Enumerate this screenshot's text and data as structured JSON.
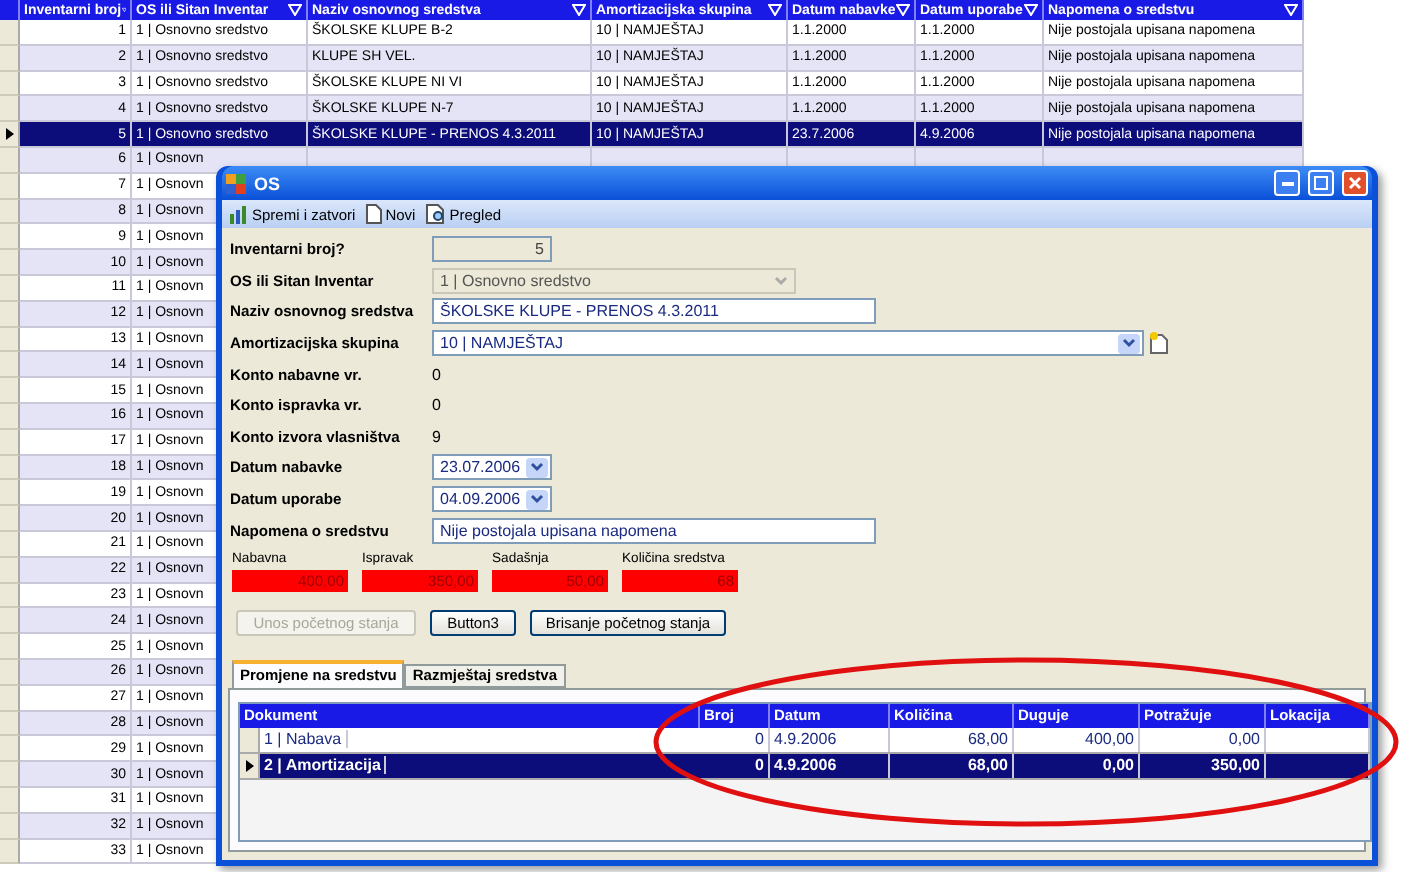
{
  "background_grid": {
    "columns": [
      "Inventarni broj",
      "OS ili Sitan Inventar",
      "Naziv osnovnog sredstva",
      "Amortizacijska skupina",
      "Datum nabavke",
      "Datum uporabe",
      "Napomena o sredstvu"
    ],
    "rows": [
      {
        "selected": false,
        "cells": [
          "1",
          "1 | Osnovno sredstvo",
          "ŠKOLSKE KLUPE B-2",
          "10 | NAMJEŠTAJ",
          "1.1.2000",
          "1.1.2000",
          "Nije postojala upisana napomena"
        ]
      },
      {
        "selected": false,
        "cells": [
          "2",
          "1 | Osnovno sredstvo",
          "KLUPE SH VEL.",
          "10 | NAMJEŠTAJ",
          "1.1.2000",
          "1.1.2000",
          "Nije postojala upisana napomena"
        ]
      },
      {
        "selected": false,
        "cells": [
          "3",
          "1 | Osnovno sredstvo",
          "ŠKOLSKE KLUPE NI VI",
          "10 | NAMJEŠTAJ",
          "1.1.2000",
          "1.1.2000",
          "Nije postojala upisana napomena"
        ]
      },
      {
        "selected": false,
        "cells": [
          "4",
          "1 | Osnovno sredstvo",
          "ŠKOLSKE KLUPE N-7",
          "10 | NAMJEŠTAJ",
          "1.1.2000",
          "1.1.2000",
          "Nije postojala upisana napomena"
        ]
      },
      {
        "selected": true,
        "cells": [
          "5",
          "1 | Osnovno sredstvo",
          "ŠKOLSKE KLUPE - PRENOS 4.3.2011",
          "10 | NAMJEŠTAJ",
          "23.7.2006",
          "4.9.2006",
          "Nije postojala upisana napomena"
        ]
      },
      {
        "selected": false,
        "cells": [
          "6",
          "1 | Osnovn"
        ]
      },
      {
        "selected": false,
        "cells": [
          "7",
          "1 | Osnovn"
        ]
      },
      {
        "selected": false,
        "cells": [
          "8",
          "1 | Osnovn"
        ]
      },
      {
        "selected": false,
        "cells": [
          "9",
          "1 | Osnovn"
        ]
      },
      {
        "selected": false,
        "cells": [
          "10",
          "1 | Osnovn"
        ]
      },
      {
        "selected": false,
        "cells": [
          "11",
          "1 | Osnovn"
        ]
      },
      {
        "selected": false,
        "cells": [
          "12",
          "1 | Osnovn"
        ]
      },
      {
        "selected": false,
        "cells": [
          "13",
          "1 | Osnovn"
        ]
      },
      {
        "selected": false,
        "cells": [
          "14",
          "1 | Osnovn"
        ]
      },
      {
        "selected": false,
        "cells": [
          "15",
          "1 | Osnovn"
        ]
      },
      {
        "selected": false,
        "cells": [
          "16",
          "1 | Osnovn"
        ]
      },
      {
        "selected": false,
        "cells": [
          "17",
          "1 | Osnovn"
        ]
      },
      {
        "selected": false,
        "cells": [
          "18",
          "1 | Osnovn"
        ]
      },
      {
        "selected": false,
        "cells": [
          "19",
          "1 | Osnovn"
        ]
      },
      {
        "selected": false,
        "cells": [
          "20",
          "1 | Osnovn"
        ]
      },
      {
        "selected": false,
        "cells": [
          "21",
          "1 | Osnovn"
        ]
      },
      {
        "selected": false,
        "cells": [
          "22",
          "1 | Osnovn"
        ]
      },
      {
        "selected": false,
        "cells": [
          "23",
          "1 | Osnovn"
        ]
      },
      {
        "selected": false,
        "cells": [
          "24",
          "1 | Osnovn"
        ]
      },
      {
        "selected": false,
        "cells": [
          "25",
          "1 | Osnovn"
        ]
      },
      {
        "selected": false,
        "cells": [
          "26",
          "1 | Osnovn"
        ]
      },
      {
        "selected": false,
        "cells": [
          "27",
          "1 | Osnovn"
        ]
      },
      {
        "selected": false,
        "cells": [
          "28",
          "1 | Osnovn"
        ]
      },
      {
        "selected": false,
        "cells": [
          "29",
          "1 | Osnovn"
        ]
      },
      {
        "selected": false,
        "cells": [
          "30",
          "1 | Osnovn"
        ]
      },
      {
        "selected": false,
        "cells": [
          "31",
          "1 | Osnovn"
        ]
      },
      {
        "selected": false,
        "cells": [
          "32",
          "1 | Osnovn"
        ]
      },
      {
        "selected": false,
        "cells": [
          "33",
          "1 | Osnovn"
        ]
      }
    ]
  },
  "window": {
    "title": "OS",
    "toolbar": [
      {
        "kind": "save",
        "label": "Spremi i zatvori"
      },
      {
        "kind": "new",
        "label": "Novi"
      },
      {
        "kind": "preview",
        "label": "Pregled"
      }
    ],
    "fields": [
      {
        "kind": "number",
        "label": "Inventarni broj?",
        "value": "5"
      },
      {
        "kind": "combo",
        "label": "OS ili Sitan Inventar",
        "value": "1 | Osnovno sredstvo",
        "disabled": true,
        "add_button": false
      },
      {
        "kind": "text",
        "label": "Naziv osnovnog sredstva",
        "value": "ŠKOLSKE KLUPE - PRENOS 4.3.2011"
      },
      {
        "kind": "combo",
        "label": "Amortizacijska skupina",
        "value": "10 | NAMJEŠTAJ",
        "disabled": false,
        "add_button": true
      },
      {
        "kind": "static",
        "label": "Konto nabavne vr.",
        "value": "0"
      },
      {
        "kind": "static",
        "label": "Konto ispravka vr.",
        "value": "0"
      },
      {
        "kind": "static",
        "label": "Konto izvora vlasništva",
        "value": "9"
      },
      {
        "kind": "date",
        "label": "Datum nabavke",
        "value": "23.07.2006"
      },
      {
        "kind": "date",
        "label": "Datum uporabe",
        "value": "04.09.2006"
      },
      {
        "kind": "text",
        "label": "Napomena o sredstvu",
        "value": "Nije postojala upisana napomena"
      }
    ],
    "totals": [
      {
        "label": "Nabavna",
        "value": "400,00"
      },
      {
        "label": "Ispravak",
        "value": "350,00"
      },
      {
        "label": "Sadašnja",
        "value": "50,00"
      },
      {
        "label": "Količina sredstva",
        "value": "68"
      }
    ],
    "buttons": [
      {
        "label": "Unos početnog stanja",
        "disabled": true
      },
      {
        "label": "Button3",
        "disabled": false
      },
      {
        "label": "Brisanje početnog stanja",
        "disabled": false
      }
    ],
    "tabs": [
      {
        "label": "Promjene na sredstvu",
        "selected": true
      },
      {
        "label": "Razmještaj sredstva",
        "selected": false
      }
    ],
    "grid": {
      "columns": [
        "Dokument",
        "Broj",
        "Datum",
        "Količina",
        "Duguje",
        "Potražuje",
        "Lokacija"
      ],
      "rows": [
        {
          "selected": false,
          "cells": [
            "1 | Nabava",
            "0",
            "4.9.2006",
            "68,00",
            "400,00",
            "0,00"
          ]
        },
        {
          "selected": true,
          "cells": [
            "2 | Amortizacija",
            "0",
            "4.9.2006",
            "68,00",
            "0,00",
            "350,00"
          ]
        }
      ]
    }
  }
}
